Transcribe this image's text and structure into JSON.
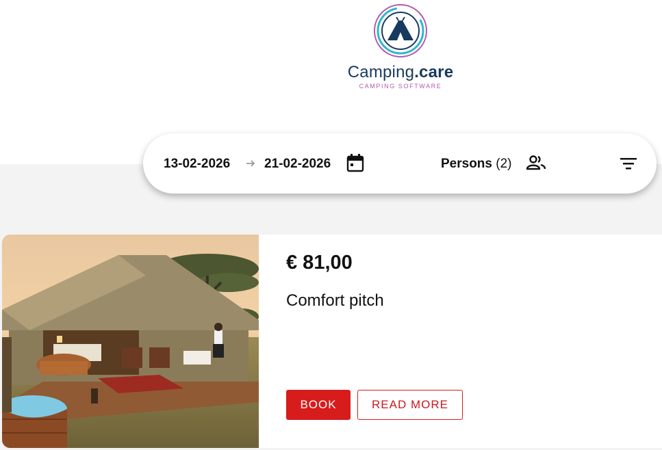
{
  "logo": {
    "name_part1": "Camping",
    "name_part2": ".care",
    "tagline": "CAMPING SOFTWARE"
  },
  "search": {
    "date_from": "13-02-2026",
    "date_to": "21-02-2026",
    "persons_label": "Persons",
    "persons_count": "(2)",
    "icons": [
      "arrow-right-icon",
      "calendar-icon",
      "people-icon",
      "filter-icon"
    ]
  },
  "result": {
    "price": "€ 81,00",
    "title": "Comfort pitch",
    "book_label": "BOOK",
    "read_more_label": "READ MORE"
  },
  "colors": {
    "accent_red": "#d71c1c",
    "logo_navy": "#173a5e",
    "logo_magenta": "#b25aa8",
    "logo_cyan": "#2bb7d6",
    "background_band": "#f3f3f3"
  }
}
